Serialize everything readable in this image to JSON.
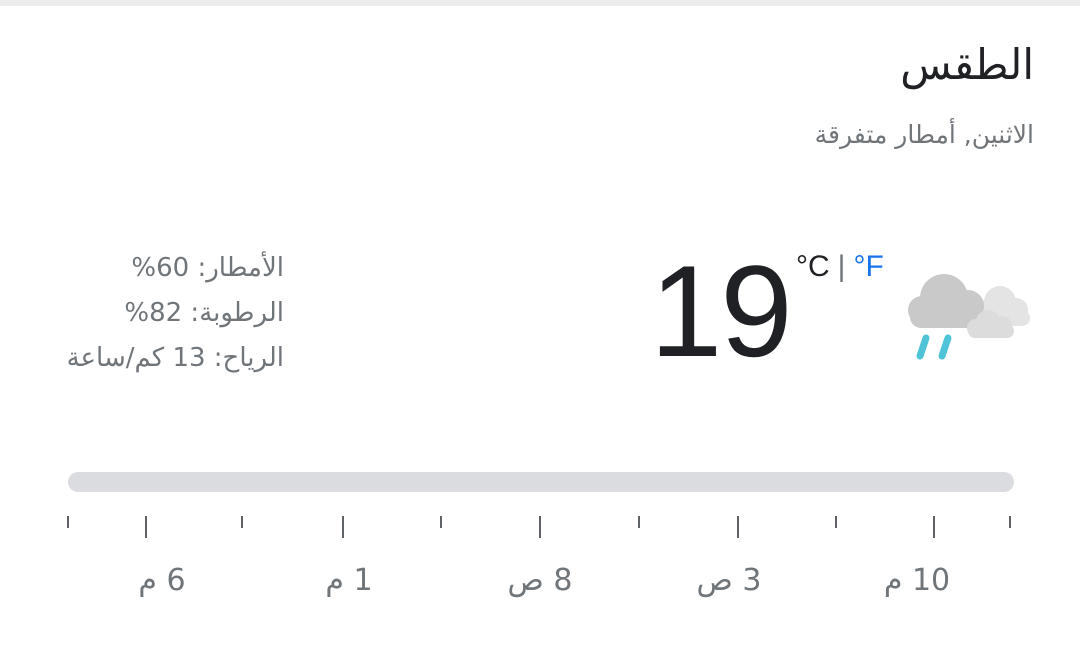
{
  "card": {
    "title": "الطقس",
    "subtitle": "الاثنين, أمطار متفرقة"
  },
  "current": {
    "temperature": "19",
    "unit_celsius": "°C",
    "unit_separator": "|",
    "unit_fahrenheit": "°F",
    "condition_icon": "rain-cloud-icon"
  },
  "stats": {
    "precipitation": "الأمطار: 60%",
    "humidity": "الرطوبة: 82%",
    "wind": "الرياح: 13 كم/ساعة"
  },
  "timeline": {
    "labels": [
      "6 م",
      "1 م",
      "8 ص",
      "3 ص",
      "10 م"
    ]
  },
  "colors": {
    "primary_text": "#202124",
    "secondary_text": "#70757a",
    "accent": "#1a73e8",
    "bar": "#dadce0",
    "rain": "#4fc3d7",
    "cloud": "#d0d0d0"
  }
}
